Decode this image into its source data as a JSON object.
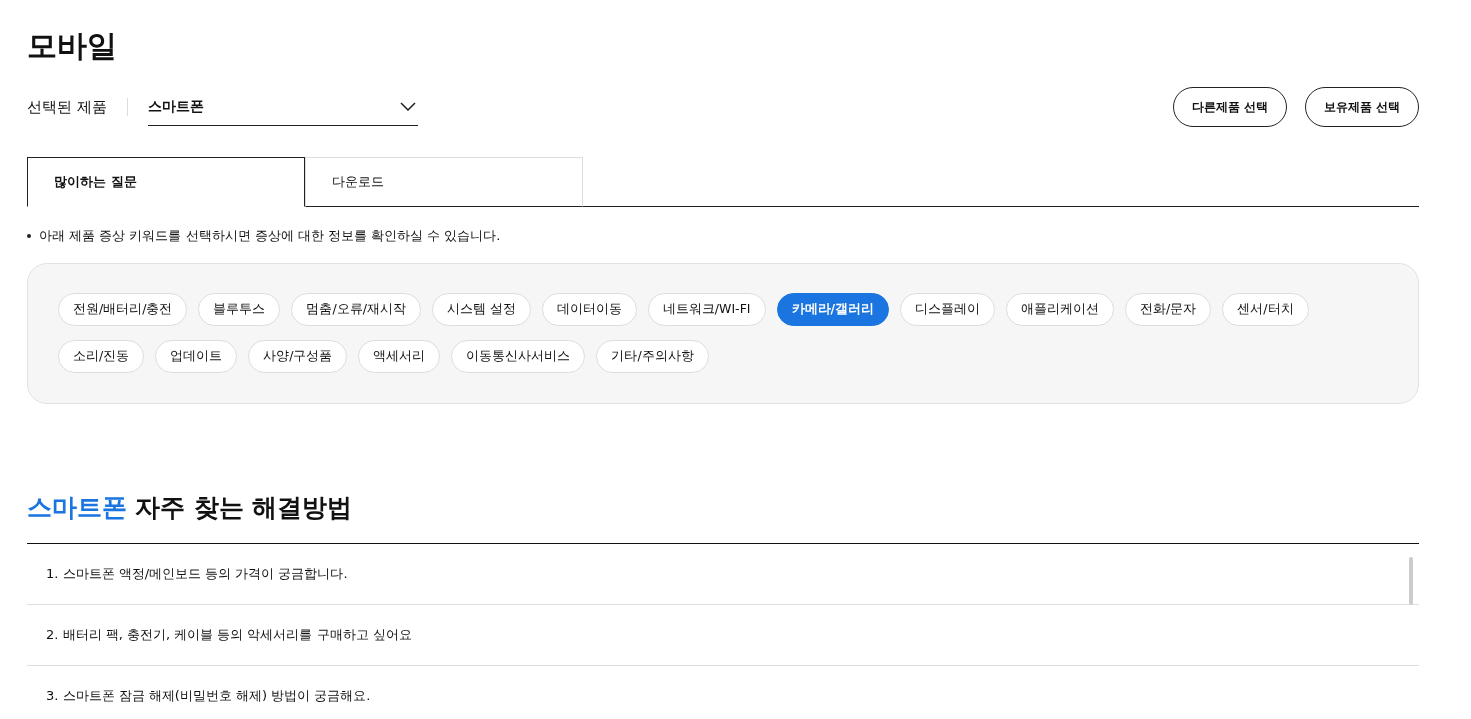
{
  "page_title": "모바일",
  "product_selector": {
    "label": "선택된 제품",
    "value": "스마트폰"
  },
  "buttons": [
    "다른제품 선택",
    "보유제품 선택"
  ],
  "tabs": [
    {
      "label": "많이하는 질문",
      "selected": true
    },
    {
      "label": "다운로드",
      "selected": false
    }
  ],
  "notice": "아래 제품 증상 키워드를 선택하시면 증상에 대한 정보를 확인하실 수 있습니다.",
  "keywords": [
    {
      "label": "전원/배터리/충전",
      "selected": false
    },
    {
      "label": "블루투스",
      "selected": false
    },
    {
      "label": "멈춤/오류/재시작",
      "selected": false
    },
    {
      "label": "시스템 설정",
      "selected": false
    },
    {
      "label": "데이터이동",
      "selected": false
    },
    {
      "label": "네트워크/WI-FI",
      "selected": false
    },
    {
      "label": "카메라/갤러리",
      "selected": true
    },
    {
      "label": "디스플레이",
      "selected": false
    },
    {
      "label": "애플리케이션",
      "selected": false
    },
    {
      "label": "전화/문자",
      "selected": false
    },
    {
      "label": "센서/터치",
      "selected": false
    },
    {
      "label": "소리/진동",
      "selected": false
    },
    {
      "label": "업데이트",
      "selected": false
    },
    {
      "label": "사양/구성품",
      "selected": false
    },
    {
      "label": "액세서리",
      "selected": false
    },
    {
      "label": "이동통신사서비스",
      "selected": false
    },
    {
      "label": "기타/주의사항",
      "selected": false
    }
  ],
  "faq_section": {
    "product": "스마트폰",
    "title": "자주 찾는 해결방법",
    "items": [
      "1. 스마트폰 액정/메인보드 등의 가격이 궁금합니다.",
      "2. 배터리 팩, 충전기, 케이블 등의 악세서리를 구매하고 싶어요",
      "3. 스마트폰 잠금 해제(비밀번호 해제) 방법이 궁금해요."
    ]
  }
}
